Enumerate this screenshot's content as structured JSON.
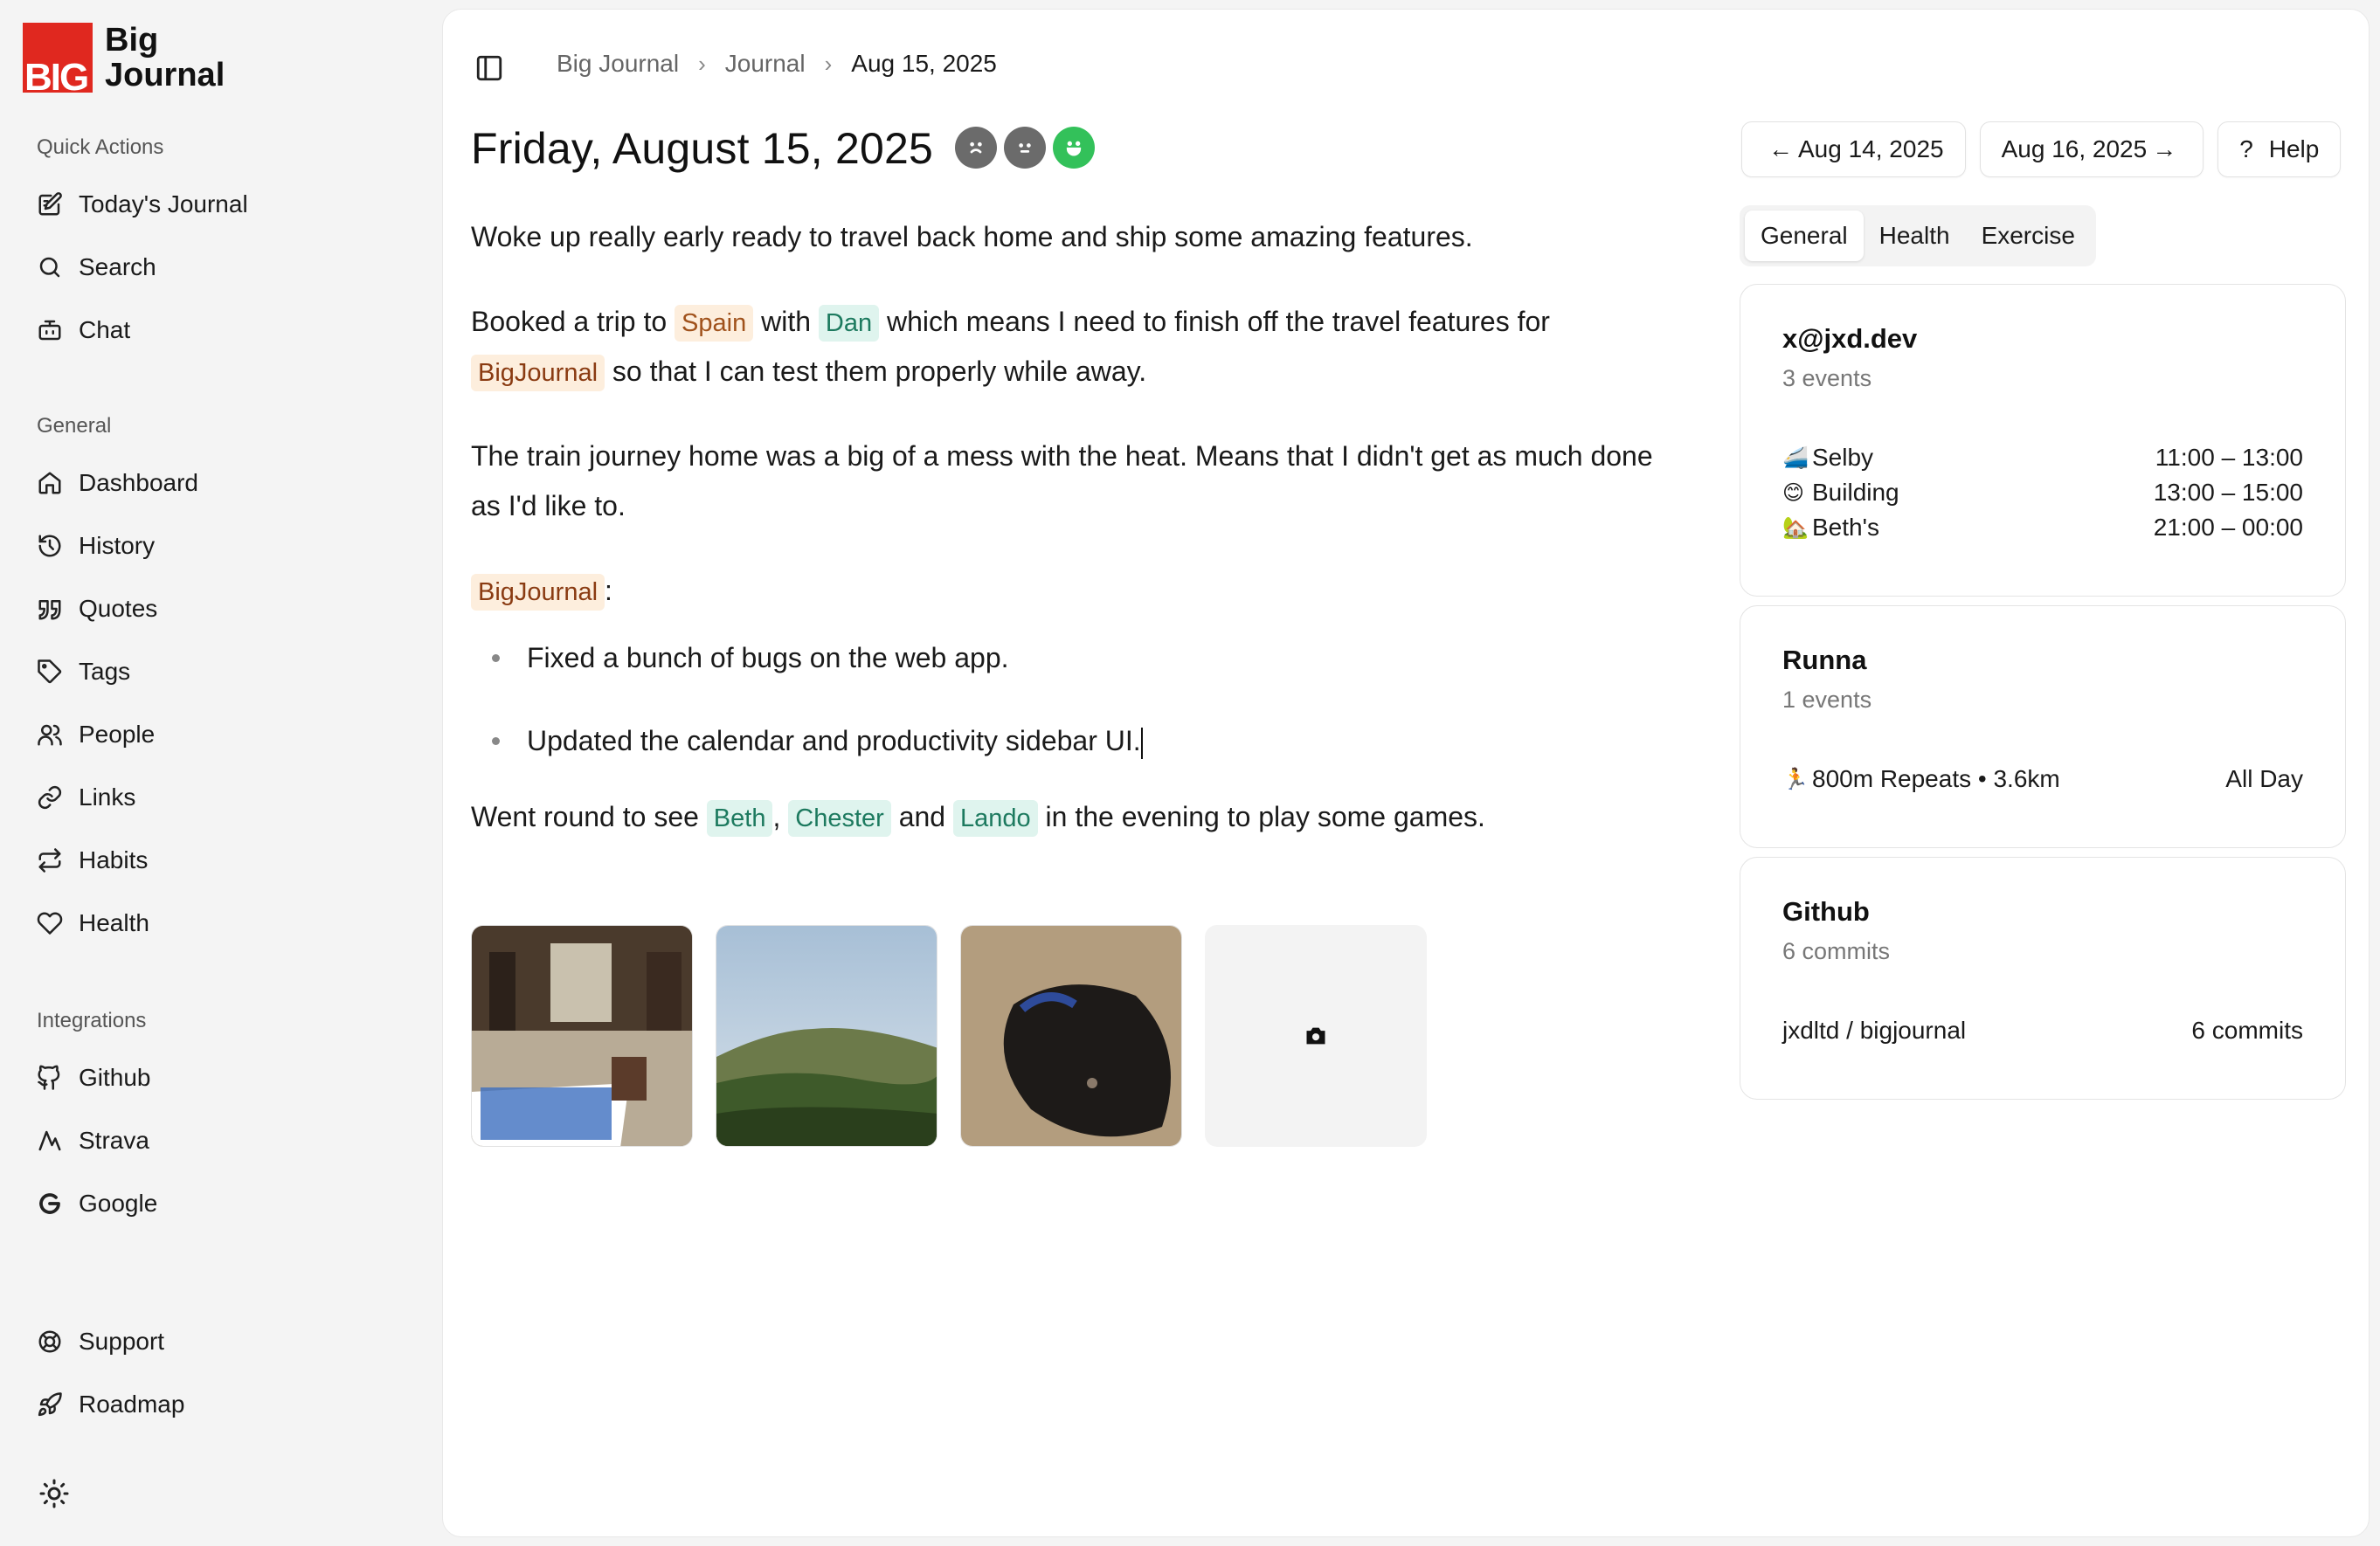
{
  "brand": {
    "mark": "BIG",
    "line1": "Big",
    "line2": "Journal",
    "color": "#e0281f"
  },
  "sidebar": {
    "quick_actions_label": "Quick Actions",
    "quick_actions": [
      {
        "label": "Today's Journal",
        "icon": "edit-icon"
      },
      {
        "label": "Search",
        "icon": "search-icon"
      },
      {
        "label": "Chat",
        "icon": "bot-icon"
      }
    ],
    "general_label": "General",
    "general": [
      {
        "label": "Dashboard",
        "icon": "home-icon"
      },
      {
        "label": "History",
        "icon": "history-icon"
      },
      {
        "label": "Quotes",
        "icon": "quote-icon"
      },
      {
        "label": "Tags",
        "icon": "tag-icon"
      },
      {
        "label": "People",
        "icon": "people-icon"
      },
      {
        "label": "Links",
        "icon": "link-icon"
      },
      {
        "label": "Habits",
        "icon": "repeat-icon"
      },
      {
        "label": "Health",
        "icon": "heart-icon"
      }
    ],
    "integrations_label": "Integrations",
    "integrations": [
      {
        "label": "Github",
        "icon": "github-icon"
      },
      {
        "label": "Strava",
        "icon": "activity-icon"
      },
      {
        "label": "Google",
        "icon": "google-icon"
      }
    ],
    "footer": [
      {
        "label": "Support",
        "icon": "lifebuoy-icon"
      },
      {
        "label": "Roadmap",
        "icon": "rocket-icon"
      }
    ],
    "theme_icon": "sun-icon"
  },
  "breadcrumb": {
    "root": "Big Journal",
    "section": "Journal",
    "current": "Aug 15, 2025"
  },
  "page": {
    "title": "Friday, August 15, 2025",
    "moods": [
      "sad",
      "neutral",
      "happy"
    ],
    "selected_mood": "happy",
    "mood_color": "#33c15a"
  },
  "entry": {
    "p1": "Woke up really early ready to travel back home and ship some amazing features.",
    "p2": {
      "a": "Booked a trip to",
      "tag_place": "Spain",
      "b": "with",
      "tag_person": "Dan",
      "c": "which means I need to finish off the travel features for",
      "tag_project": "BigJournal",
      "d": "so that I can test them properly while away."
    },
    "p3": "The train journey home was a big of a mess with the heat. Means that I didn't get as much done as I'd like to.",
    "p4": {
      "tag_project": "BigJournal",
      "colon": ":"
    },
    "bullets": [
      "Fixed a bunch of bugs on the web app.",
      "Updated the calendar and productivity sidebar UI."
    ],
    "p5": {
      "a": "Went round to see",
      "tag1": "Beth",
      "comma": ",",
      "tag2": "Chester",
      "b": "and",
      "tag3": "Lando",
      "c": "in the evening to play some games."
    }
  },
  "photos": [
    "bar-interior",
    "hill-landscape",
    "dog-on-rug"
  ],
  "nav": {
    "prev": "Aug 14, 2025",
    "next": "Aug 16, 2025",
    "help": "Help",
    "help_glyph": "?"
  },
  "tabs": [
    "General",
    "Health",
    "Exercise"
  ],
  "active_tab": "General",
  "cards": [
    {
      "title": "x@jxd.dev",
      "subtitle": "3 events",
      "rows": [
        {
          "emoji": "🚄",
          "name": "Selby",
          "value": "11:00 – 13:00"
        },
        {
          "emoji": "😊",
          "name": "Building",
          "value": "13:00 – 15:00"
        },
        {
          "emoji": "🏡",
          "name": "Beth's",
          "value": "21:00 – 00:00"
        }
      ]
    },
    {
      "title": "Runna",
      "subtitle": "1 events",
      "rows": [
        {
          "emoji": "🏃",
          "name": "800m Repeats • 3.6km",
          "value": "All Day"
        }
      ]
    },
    {
      "title": "Github",
      "subtitle": "6 commits",
      "rows": [
        {
          "emoji": "",
          "name": "jxdltd / bigjournal",
          "value": "6 commits"
        }
      ]
    }
  ]
}
